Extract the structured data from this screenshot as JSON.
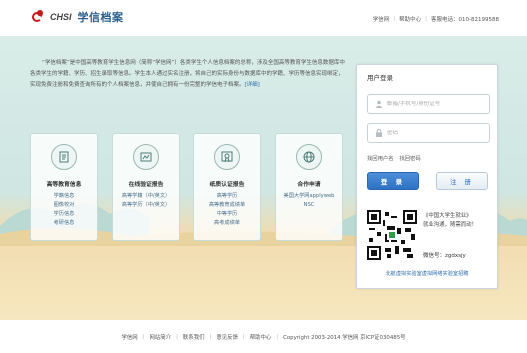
{
  "header": {
    "logo_en": "CHSI",
    "logo_cn": "学信档案",
    "links": [
      "学信网",
      "帮助中心"
    ],
    "hotline": "客服电话：010-82199588"
  },
  "intro": {
    "text": "“学信档案”是中国高等教育学生信息网（简称“学信网”）各类学生个人信息档案的总称，涉及全国高等教育学生信息数据库中各类学生的学籍、学历、招生录取等信息。学生本人通过实名注册，将自己的实际身份与数据库中的学籍、学历等信息实现绑定，实现免费注册和免费查询所有的个人档案信息，并使自己拥有一份完整的学信电子档案。",
    "more": "[详细]"
  },
  "cards": [
    {
      "title": "高等教育信息",
      "lines": [
        "学籍信息",
        "图像校对",
        "学历信息",
        "考研信息"
      ],
      "icon": "document-icon"
    },
    {
      "title": "在线验证报告",
      "lines": [
        "高等学籍（中/英文）",
        "高等学历（中/英文）"
      ],
      "icon": "report-icon"
    },
    {
      "title": "纸质认证报告",
      "lines": [
        "高等学历",
        "高等教育成绩单",
        "中等学历",
        "高考成绩单"
      ],
      "icon": "certificate-icon"
    },
    {
      "title": "合作申请",
      "lines": [
        "美国大学网applyweb",
        "NSC"
      ],
      "icon": "globe-icon"
    }
  ],
  "login": {
    "title": "用户登录",
    "username_placeholder": "邮箱/手机号/身份证号",
    "password_placeholder": "密码",
    "find_username": "找回用户名",
    "find_password": "找回密码",
    "login_button": "登 录",
    "register_button": "注 册",
    "qr_text_1": "《中国大学生就业》",
    "qr_text_2": "就业沟通，随需而动！",
    "wechat": "微信号：zgdxsjy",
    "footer_link": "北航虚拟实验室虚拟网络实验室招聘"
  },
  "footer": {
    "links": [
      "学信网",
      "网站简介",
      "联系我们",
      "意见反馈",
      "帮助中心"
    ],
    "copyright": "Copyright 2003-2014 学信网 京ICP证030485号"
  },
  "colors": {
    "brand_red": "#c8161d",
    "brand_blue": "#2b5f8d",
    "button_blue": "#2d71c4"
  }
}
